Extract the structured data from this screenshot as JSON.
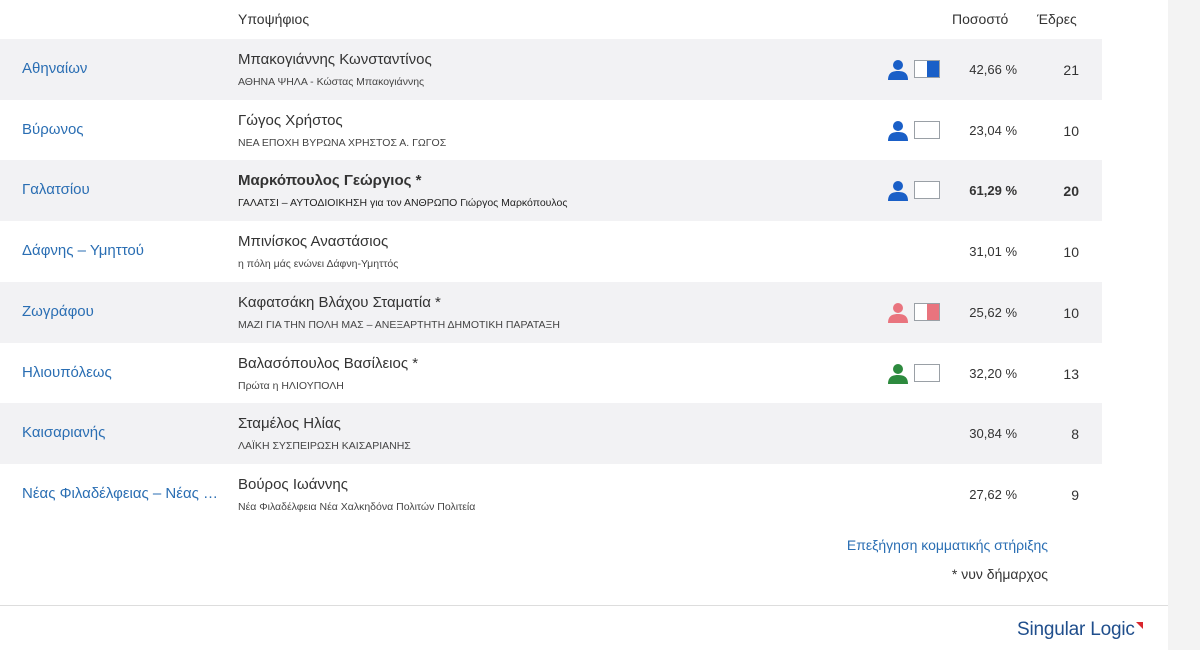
{
  "header": {
    "candidate": "Υποψήφιος",
    "percentage": "Ποσοστό",
    "seats": "Έδρες"
  },
  "colors": {
    "blue": "#1a5fc7",
    "pink": "#e9747e",
    "green": "#2d8a3e"
  },
  "rows": [
    {
      "municipality": "Αθηναίων",
      "candidate": "Μπακογιάννης Κωνσταντίνος",
      "party": "ΑΘΗΝΑ ΨΗΛΑ - Κώστας Μπακογιάννης",
      "percentage": "42,66 %",
      "seats": "21",
      "support_icon": "person-icon",
      "support_color": "blue",
      "support_fill": 0.5
    },
    {
      "municipality": "Βύρωνος",
      "candidate": "Γώγος Χρήστος",
      "party": "ΝΕΑ ΕΠΟΧΗ ΒΥΡΩΝΑ ΧΡΗΣΤΟΣ Α. ΓΩΓΟΣ",
      "percentage": "23,04 %",
      "seats": "10",
      "support_icon": "person-icon",
      "support_color": "blue",
      "support_fill": 0
    },
    {
      "municipality": "Γαλατσίου",
      "candidate": "Μαρκόπουλος Γεώργιος *",
      "party": "ΓΑΛΑΤΣΙ – ΑΥΤΟΔΙΟΙΚΗΣΗ για τον ΑΝΘΡΩΠΟ Γιώργος Μαρκόπουλος",
      "percentage": "61,29 %",
      "seats": "20",
      "support_icon": "person-icon",
      "support_color": "blue",
      "support_fill": 0
    },
    {
      "municipality": "Δάφνης – Υμηττού",
      "candidate": "Μπινίσκος Αναστάσιος",
      "party": "η πόλη μάς ενώνει Δάφνη-Υμηττός",
      "percentage": "31,01 %",
      "seats": "10",
      "support_icon": null,
      "support_color": null,
      "support_fill": 0
    },
    {
      "municipality": "Ζωγράφου",
      "candidate": "Καφατσάκη Βλάχου Σταματία *",
      "party": "ΜΑΖΙ ΓΙΑ ΤΗΝ ΠΟΛΗ ΜΑΣ – ΑΝΕΞΑΡΤΗΤΗ ΔΗΜΟΤΙΚΗ ΠΑΡΑΤΑΞΗ",
      "percentage": "25,62 %",
      "seats": "10",
      "support_icon": "person-icon",
      "support_color": "pink",
      "support_fill": 0.5
    },
    {
      "municipality": "Ηλιουπόλεως",
      "candidate": "Βαλασόπουλος Βασίλειος *",
      "party": "Πρώτα η ΗΛΙΟΥΠΟΛΗ",
      "percentage": "32,20 %",
      "seats": "13",
      "support_icon": "person-icon",
      "support_color": "green",
      "support_fill": 0
    },
    {
      "municipality": "Καισαριανής",
      "candidate": "Σταμέλος Ηλίας",
      "party": "ΛΑΪΚΗ ΣΥΣΠΕΙΡΩΣΗ ΚΑΙΣΑΡΙΑΝΗΣ",
      "percentage": "30,84 %",
      "seats": "8",
      "support_icon": null,
      "support_color": null,
      "support_fill": 0
    },
    {
      "municipality": "Νέας Φιλαδέλφειας – Νέας Χαλκηδόνας",
      "candidate": "Βούρος Ιωάννης",
      "party": "Νέα Φιλαδέλφεια Νέα Χαλκηδόνα Πολιτών Πολιτεία",
      "percentage": "27,62 %",
      "seats": "9",
      "support_icon": null,
      "support_color": null,
      "support_fill": 0
    }
  ],
  "footer": {
    "explain_link": "Επεξήγηση κομματικής στήριξης",
    "note": "* νυν δήμαρχος",
    "logo_part1": "Singular",
    "logo_part2": "Logic"
  }
}
